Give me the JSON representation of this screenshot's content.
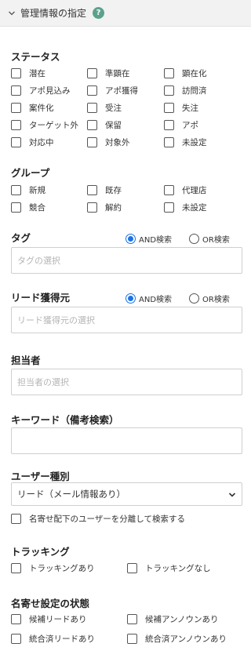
{
  "header": {
    "title": "管理情報の指定",
    "help_icon": "?"
  },
  "status": {
    "title": "ステータス",
    "options": [
      "潜在",
      "準顕在",
      "顕在化",
      "アポ見込み",
      "アポ獲得",
      "訪問済",
      "案件化",
      "受注",
      "失注",
      "ターゲット外",
      "保留",
      "アポ",
      "対応中",
      "対象外",
      "未設定"
    ]
  },
  "group": {
    "title": "グループ",
    "options": [
      "新規",
      "既存",
      "代理店",
      "競合",
      "解約",
      "未設定"
    ]
  },
  "tag": {
    "title": "タグ",
    "radio_and": "AND検索",
    "radio_or": "OR検索",
    "selected": "AND",
    "placeholder": "タグの選択"
  },
  "lead_source": {
    "title": "リード獲得元",
    "radio_and": "AND検索",
    "radio_or": "OR検索",
    "selected": "AND",
    "placeholder": "リード獲得元の選択"
  },
  "owner": {
    "title": "担当者",
    "placeholder": "担当者の選択"
  },
  "keyword": {
    "title": "キーワード（備考検索）",
    "value": ""
  },
  "user_type": {
    "title": "ユーザー種別",
    "selected": "リード（メール情報あり）",
    "separate_label": "名寄せ配下のユーザーを分離して検索する"
  },
  "tracking": {
    "title": "トラッキング",
    "options": [
      "トラッキングあり",
      "トラッキングなし"
    ]
  },
  "merge_state": {
    "title": "名寄せ設定の状態",
    "options": [
      "候補リードあり",
      "候補アンノウンあり",
      "統合済リードあり",
      "統合済アンノウンあり"
    ]
  }
}
